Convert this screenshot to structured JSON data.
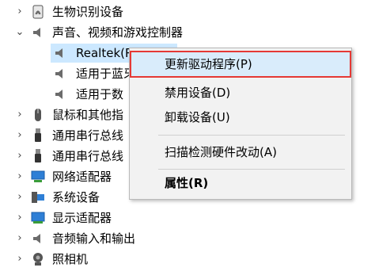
{
  "tree": {
    "items": [
      {
        "label": "生物识别设备",
        "expander": ">",
        "icon": "fingerprint-icon"
      },
      {
        "label": "声音、视频和游戏控制器",
        "expander": "v",
        "icon": "speaker-icon"
      },
      {
        "label": "Realtek(R) Audio",
        "expander": "",
        "icon": "speaker-icon"
      },
      {
        "label": "适用于蓝牙",
        "expander": "",
        "icon": "speaker-icon"
      },
      {
        "label": "适用于数",
        "expander": "",
        "icon": "speaker-icon"
      },
      {
        "label": "鼠标和其他指",
        "expander": ">",
        "icon": "mouse-icon"
      },
      {
        "label": "通用串行总线",
        "expander": ">",
        "icon": "usb-icon"
      },
      {
        "label": "通用串行总线",
        "expander": ">",
        "icon": "usb-icon"
      },
      {
        "label": "网络适配器",
        "expander": ">",
        "icon": "network-icon"
      },
      {
        "label": "系统设备",
        "expander": ">",
        "icon": "system-device-icon"
      },
      {
        "label": "显示适配器",
        "expander": ">",
        "icon": "display-adapter-icon"
      },
      {
        "label": "音频输入和输出",
        "expander": ">",
        "icon": "speaker-icon"
      },
      {
        "label": "照相机",
        "expander": ">",
        "icon": "camera-icon"
      }
    ]
  },
  "context_menu": {
    "items": [
      {
        "label": "更新驱动程序(P)",
        "highlighted": true
      },
      {
        "label": "禁用设备(D)"
      },
      {
        "label": "卸载设备(U)"
      },
      {
        "label": "扫描检测硬件改动(A)"
      },
      {
        "label": "属性(R)",
        "bold": true
      }
    ]
  },
  "colors": {
    "selection": "#cce8ff",
    "menu_bg": "#f2f2f2",
    "highlight_border": "#e53935"
  }
}
